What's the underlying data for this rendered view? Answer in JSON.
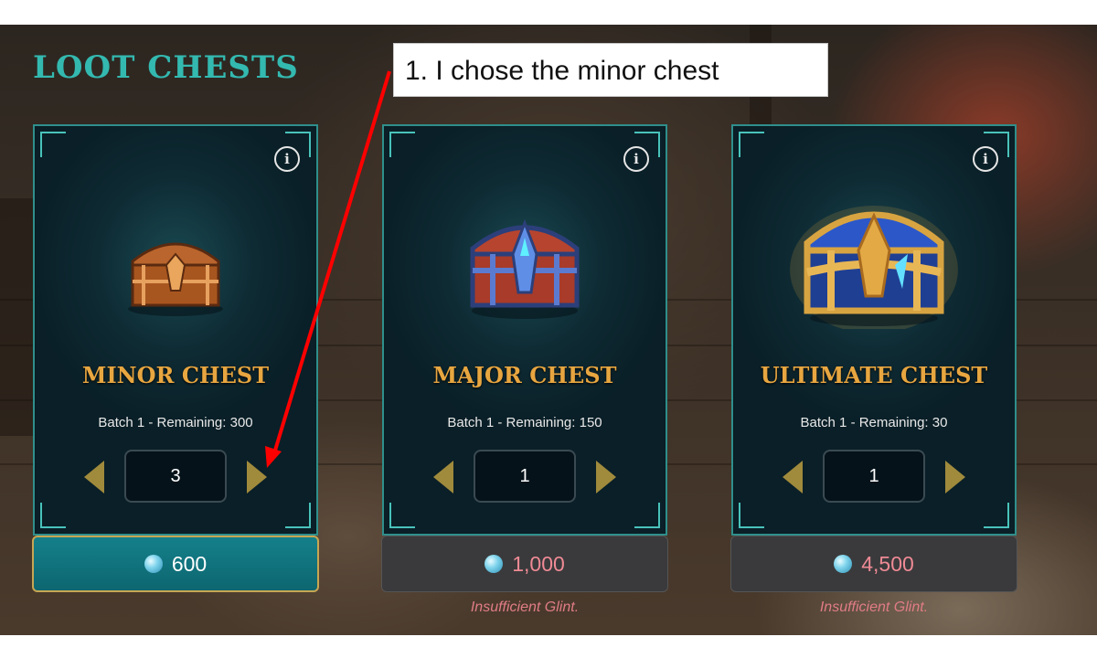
{
  "page_title": "LOOT CHESTS",
  "annotation": {
    "text": "1. I chose the minor chest"
  },
  "cards": [
    {
      "name": "MINOR CHEST",
      "batch": "Batch 1 - Remaining: 300",
      "quantity": "3",
      "price": "600",
      "warning": ""
    },
    {
      "name": "MAJOR CHEST",
      "batch": "Batch 1 - Remaining: 150",
      "quantity": "1",
      "price": "1,000",
      "warning": "Insufficient Glint."
    },
    {
      "name": "ULTIMATE CHEST",
      "batch": "Batch 1 - Remaining: 30",
      "quantity": "1",
      "price": "4,500",
      "warning": "Insufficient Glint."
    }
  ],
  "icons": {
    "info": "info-icon",
    "prev": "chevron-left-icon",
    "next": "chevron-right-icon",
    "currency": "glint-gem-icon"
  },
  "colors": {
    "accent_teal": "#33b9b0",
    "chest_name_gold": "#e8a640",
    "insufficient_red": "#e07c85",
    "annotation_arrow": "#ff0000"
  }
}
